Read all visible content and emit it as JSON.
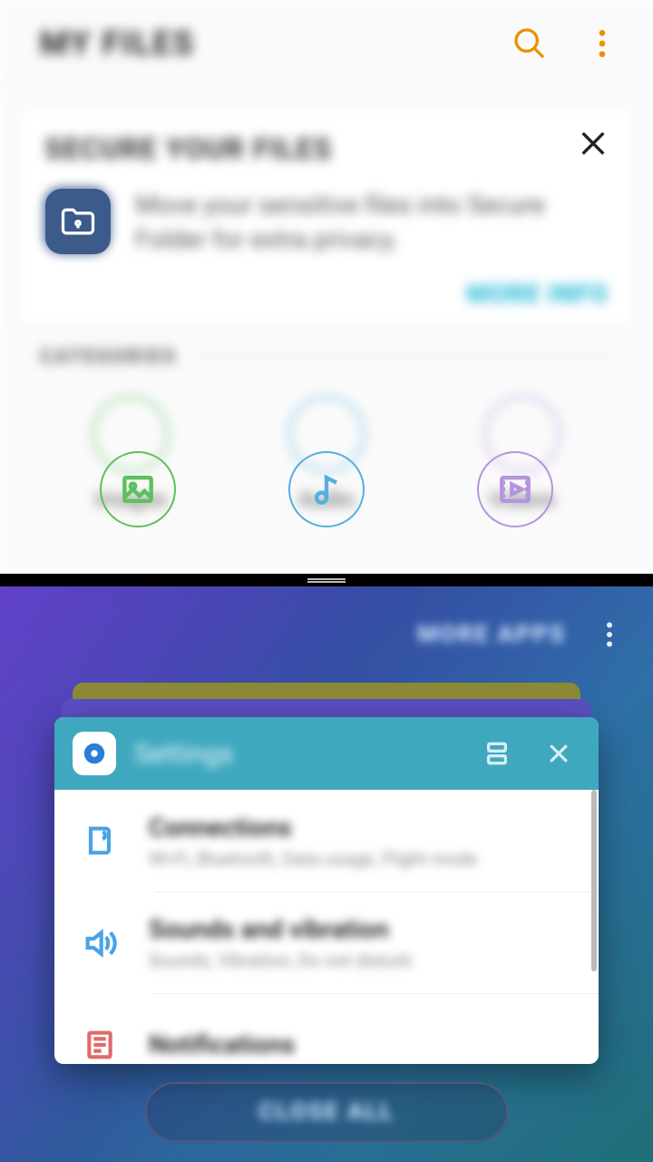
{
  "top_app": {
    "title": "MY FILES",
    "promo": {
      "title": "SECURE YOUR FILES",
      "text": "Move your sensitive files into Secure Folder for extra privacy.",
      "action": "MORE INFO"
    },
    "section_label": "CATEGORIES",
    "categories": [
      {
        "label": "Images"
      },
      {
        "label": "Audio"
      },
      {
        "label": "Videos"
      }
    ]
  },
  "recents": {
    "more_apps": "MORE APPS",
    "foreground_card": {
      "title": "Settings",
      "rows": [
        {
          "title": "Connections",
          "sub": "Wi-Fi, Bluetooth, Data usage, Flight mode"
        },
        {
          "title": "Sounds and vibration",
          "sub": "Sounds, Vibration, Do not disturb"
        },
        {
          "title": "Notifications",
          "sub": ""
        }
      ]
    },
    "close_all": "CLOSE ALL"
  }
}
